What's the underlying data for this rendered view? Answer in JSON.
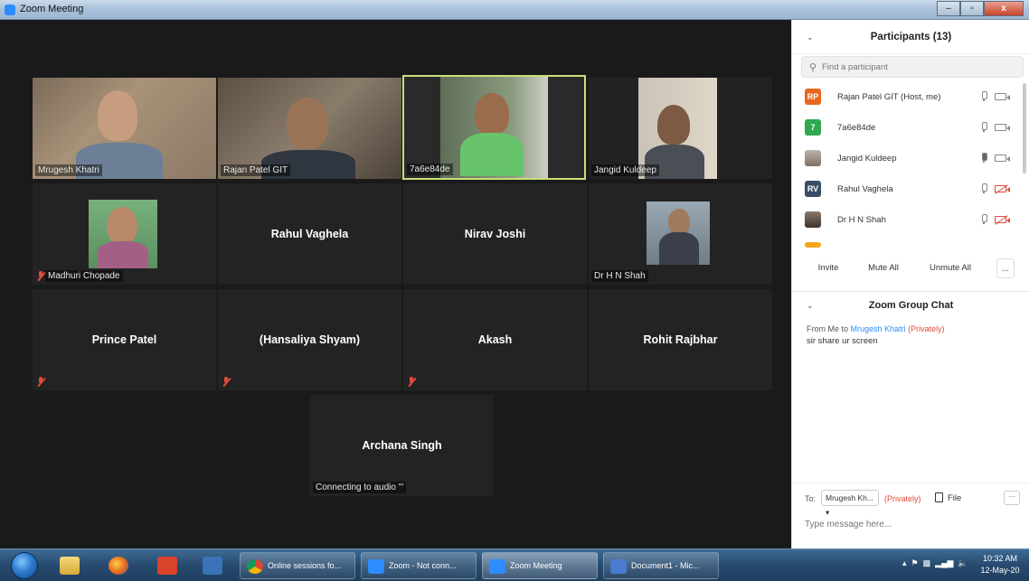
{
  "window": {
    "title": "Zoom Meeting",
    "minimize": "–",
    "maximize": "▫",
    "close": "x"
  },
  "tiles": {
    "mrugesh": "Mrugesh Khatri",
    "rajan": "Rajan Patel GIT",
    "seven": "7a6e84de",
    "jangid": "Jangid Kuldeep",
    "madhuri": "Madhuri Chopade",
    "rahul": "Rahul Vaghela",
    "nirav": "Nirav Joshi",
    "shah": "Dr H N Shah",
    "prince": "Prince Patel",
    "hansaliya": "(Hansaliya Shyam)",
    "akash": "Akash",
    "rohit": "Rohit Rajbhar",
    "archana": "Archana Singh",
    "archana_status": "Connecting to audio '''"
  },
  "participants": {
    "title": "Participants (13)",
    "search_placeholder": "Find a participant",
    "list": [
      {
        "initials": "RP",
        "name": "Rajan Patel GIT (Host, me)",
        "color": "#e8671e"
      },
      {
        "initials": "7",
        "name": "7a6e84de",
        "color": "#2fa84f"
      },
      {
        "initials": "",
        "name": "Jangid Kuldeep",
        "color": "#9a8f86"
      },
      {
        "initials": "RV",
        "name": "Rahul Vaghela",
        "color": "#3a4e66"
      },
      {
        "initials": "",
        "name": "Dr H N Shah",
        "color": "#5a4a3d"
      }
    ],
    "invite": "Invite",
    "mute_all": "Mute All",
    "unmute_all": "Unmute All",
    "more": "..."
  },
  "chat": {
    "title": "Zoom Group Chat",
    "from": "From Me to",
    "to_name": "Mrugesh Khatri",
    "privately": "(Privately)",
    "message": "sir share ur screen",
    "to_label": "To:",
    "recipient": "Mrugesh Kh...",
    "recipient_privately": "(Privately)",
    "file": "File",
    "more": "···",
    "input_placeholder": "Type message here..."
  },
  "taskbar": {
    "items": [
      "Online sessions fo...",
      "Zoom - Not conn...",
      "Zoom Meeting",
      "Document1 - Mic..."
    ],
    "time": "10:32 AM",
    "date": "12-May-20"
  }
}
